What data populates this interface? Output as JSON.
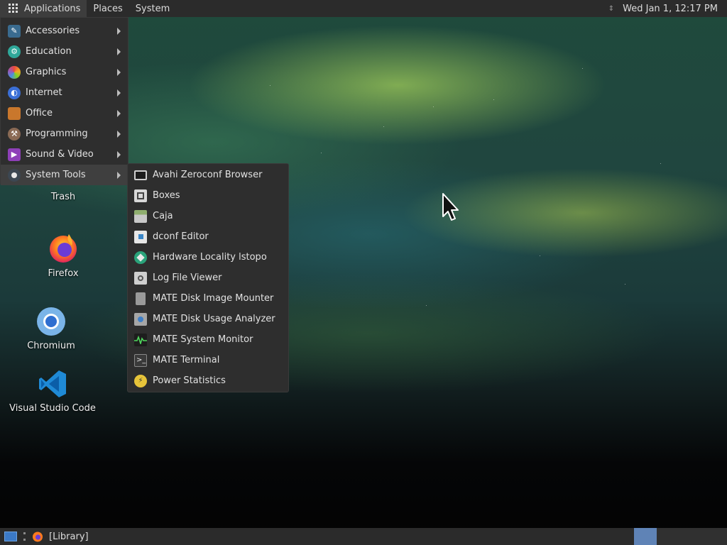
{
  "top_panel": {
    "menus": [
      "Applications",
      "Places",
      "System"
    ],
    "clock": "Wed Jan 1, 12:17 PM"
  },
  "app_menu": {
    "categories": [
      {
        "label": "Accessories",
        "icon": "accessories-icon"
      },
      {
        "label": "Education",
        "icon": "education-icon"
      },
      {
        "label": "Graphics",
        "icon": "graphics-icon"
      },
      {
        "label": "Internet",
        "icon": "internet-icon"
      },
      {
        "label": "Office",
        "icon": "office-icon"
      },
      {
        "label": "Programming",
        "icon": "programming-icon"
      },
      {
        "label": "Sound & Video",
        "icon": "sound-video-icon"
      },
      {
        "label": "System Tools",
        "icon": "system-tools-icon"
      }
    ],
    "active_category": "System Tools"
  },
  "system_tools_menu": {
    "items": [
      {
        "label": "Avahi Zeroconf Browser",
        "icon": "avahi-icon"
      },
      {
        "label": "Boxes",
        "icon": "boxes-icon"
      },
      {
        "label": "Caja",
        "icon": "caja-icon"
      },
      {
        "label": "dconf Editor",
        "icon": "dconf-icon"
      },
      {
        "label": "Hardware Locality lstopo",
        "icon": "lstopo-icon"
      },
      {
        "label": "Log File Viewer",
        "icon": "log-viewer-icon"
      },
      {
        "label": "MATE Disk Image Mounter",
        "icon": "disk-mounter-icon"
      },
      {
        "label": "MATE Disk Usage Analyzer",
        "icon": "disk-usage-icon"
      },
      {
        "label": "MATE System Monitor",
        "icon": "system-monitor-icon"
      },
      {
        "label": "MATE Terminal",
        "icon": "terminal-icon"
      },
      {
        "label": "Power Statistics",
        "icon": "power-stats-icon"
      }
    ]
  },
  "desktop_icons": [
    {
      "label": "Trash",
      "icon": "trash-icon"
    },
    {
      "label": "Firefox",
      "icon": "firefox-icon"
    },
    {
      "label": "Chromium",
      "icon": "chromium-icon"
    },
    {
      "label": "Visual Studio Code",
      "icon": "vscode-icon"
    }
  ],
  "bottom_panel": {
    "task_label": "[Library]"
  },
  "colors": {
    "panel": "#2b2b2b",
    "menu_bg": "#2e2e2e",
    "active_item": "#3f3f3f",
    "workspace_active": "#5f83b6"
  }
}
